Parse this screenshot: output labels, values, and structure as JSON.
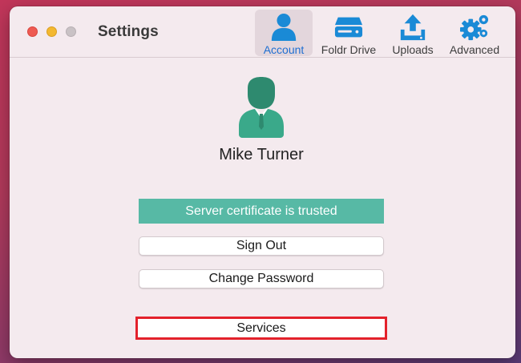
{
  "window": {
    "title": "Settings"
  },
  "tabs": [
    {
      "label": "Account",
      "icon": "person-icon",
      "active": true
    },
    {
      "label": "Foldr Drive",
      "icon": "drive-icon",
      "active": false
    },
    {
      "label": "Uploads",
      "icon": "upload-icon",
      "active": false
    },
    {
      "label": "Advanced",
      "icon": "gears-icon",
      "active": false
    }
  ],
  "account": {
    "user_name": "Mike Turner",
    "avatar_icon": "businessman-avatar-icon",
    "certificate_status": "Server certificate is trusted",
    "sign_out_label": "Sign Out",
    "change_password_label": "Change Password",
    "services_label": "Services"
  },
  "colors": {
    "accent_blue": "#1f6fd1",
    "icon_blue": "#1a8ad6",
    "status_green": "#57b9a5",
    "highlight_red": "#e3212b"
  }
}
